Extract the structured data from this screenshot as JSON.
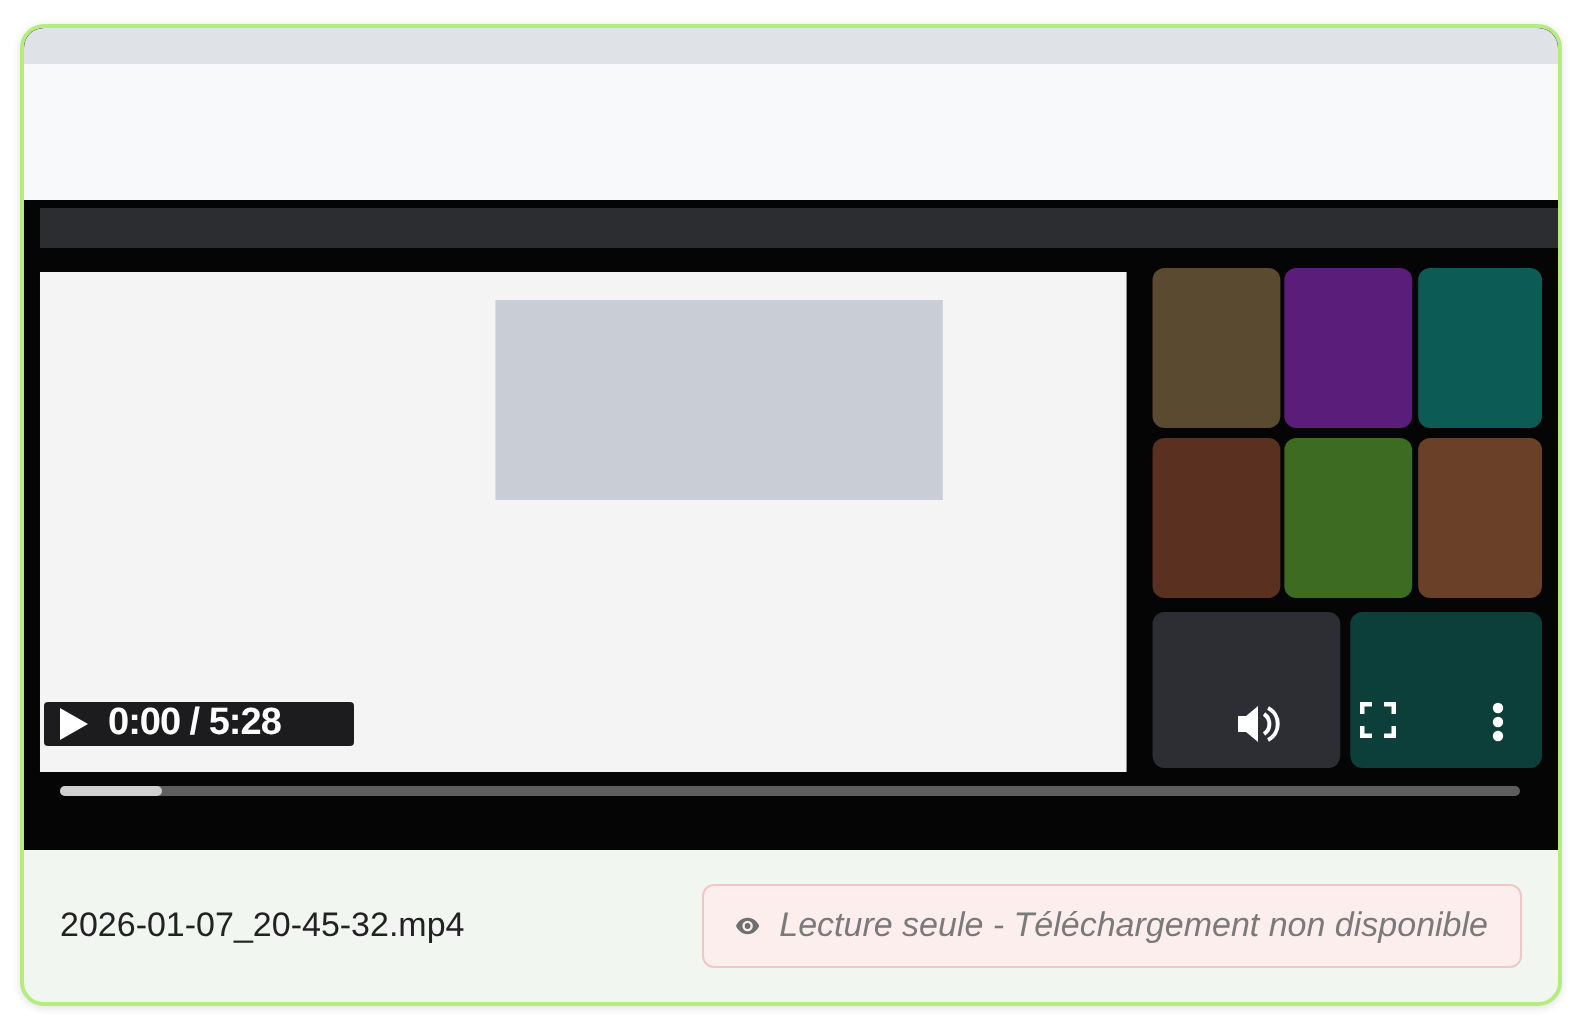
{
  "video": {
    "kind": "picture",
    "playing": false,
    "time": "0:00 / 5:28",
    "level": 0.07
  },
  "file": {
    "name": "2026-01-07_20-45-32.mp4"
  },
  "notice": {
    "text": "Lecture seule - Téléchargement non disponible"
  }
}
